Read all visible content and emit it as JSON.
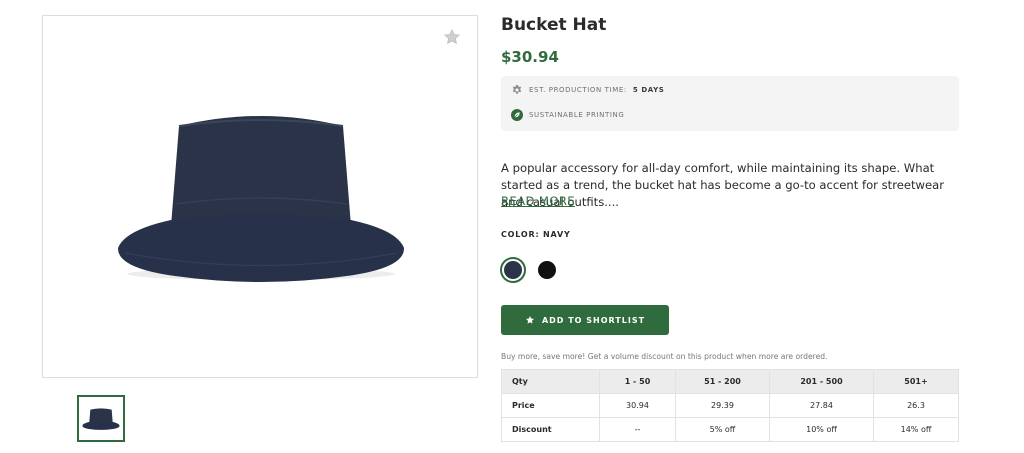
{
  "product": {
    "title": "Bucket Hat",
    "price": "$30.94",
    "description": "A popular accessory for all-day comfort, while maintaining its shape. What started as a trend, the bucket hat has become a go-to accent for streetwear and casual outfits....",
    "read_more": "READ MORE"
  },
  "features": {
    "production_label": "EST. PRODUCTION TIME:",
    "production_value": "5 DAYS",
    "sustainable": "SUSTAINABLE PRINTING"
  },
  "color": {
    "label": "COLOR: NAVY",
    "swatches": [
      {
        "name": "Navy",
        "hex": "#2a3347",
        "selected": true
      },
      {
        "name": "Black",
        "hex": "#111111",
        "selected": false
      }
    ]
  },
  "actions": {
    "shortlist_label": "ADD TO SHORTLIST"
  },
  "bulk": {
    "note": "Buy more, save more! Get a volume discount on this product when more are ordered.",
    "headers": [
      "Qty",
      "1 - 50",
      "51 - 200",
      "201 - 500",
      "501+"
    ],
    "rows": [
      [
        "Price",
        "30.94",
        "29.39",
        "27.84",
        "26.3"
      ],
      [
        "Discount",
        "--",
        "5% off",
        "10% off",
        "14% off"
      ]
    ]
  },
  "colors": {
    "accent": "#2f6b3c",
    "hat": "#2a3347"
  },
  "icons": [
    "star-icon",
    "gear-icon",
    "leaf-icon"
  ]
}
